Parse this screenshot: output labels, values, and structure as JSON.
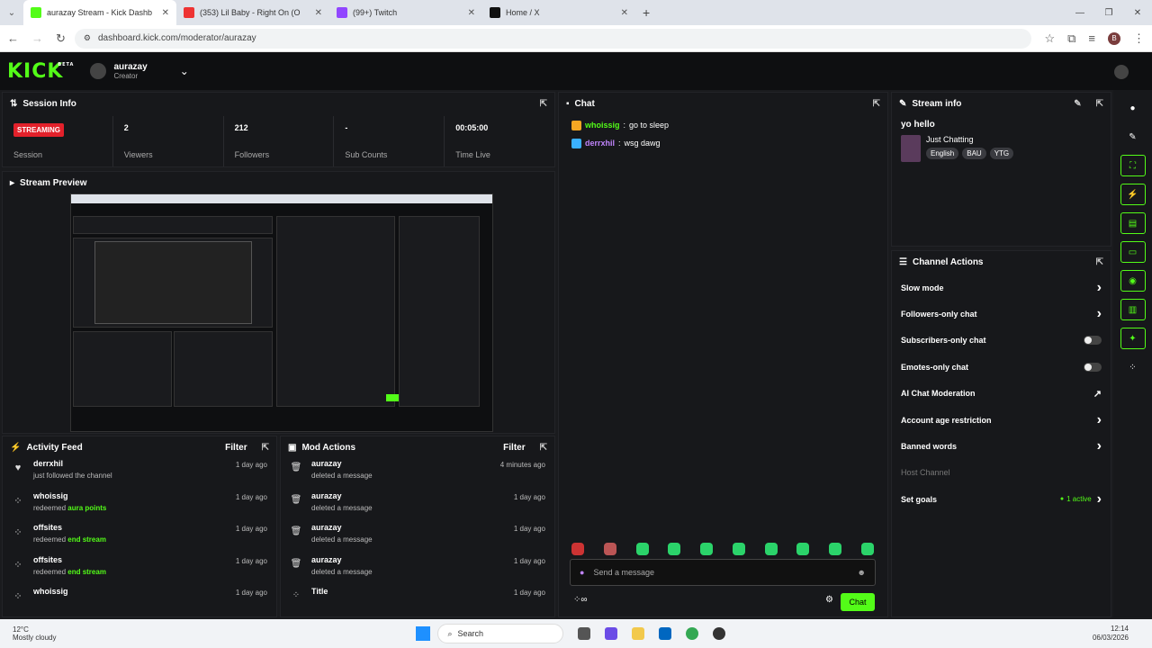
{
  "browser": {
    "tabs": [
      {
        "title": "aurazay Stream - Kick Dashb",
        "color": "#53fc18",
        "active": true
      },
      {
        "title": "(353) Lil Baby - Right On (O",
        "color": "#e33",
        "active": false
      },
      {
        "title": "(99+) Twitch",
        "color": "#9146ff",
        "active": false
      },
      {
        "title": "Home / X",
        "color": "#111",
        "active": false
      }
    ],
    "url": "dashboard.kick.com/moderator/aurazay",
    "profile_initial": "B"
  },
  "header": {
    "logo": "KICK",
    "beta": "BETA",
    "username": "aurazay",
    "role": "Creator"
  },
  "session": {
    "title": "Session Info",
    "badge": "STREAMING",
    "badge_sub": "Session",
    "stats": [
      {
        "value": "2",
        "label": "Viewers"
      },
      {
        "value": "212",
        "label": "Followers"
      },
      {
        "value": "-",
        "label": "Sub Counts"
      },
      {
        "value": "00:05:00",
        "label": "Time Live"
      }
    ]
  },
  "preview": {
    "title": "Stream Preview"
  },
  "activity": {
    "title": "Activity Feed",
    "filter": "Filter",
    "items": [
      {
        "icon": "♥",
        "name": "derrxhil",
        "sub": "just followed the channel",
        "hl": "",
        "time": "1 day ago"
      },
      {
        "icon": "⁘",
        "name": "whoissig",
        "sub": "redeemed ",
        "hl": "aura points",
        "time": "1 day ago"
      },
      {
        "icon": "⁘",
        "name": "offsites",
        "sub": "redeemed ",
        "hl": "end stream",
        "time": "1 day ago"
      },
      {
        "icon": "⁘",
        "name": "offsites",
        "sub": "redeemed ",
        "hl": "end stream",
        "time": "1 day ago"
      },
      {
        "icon": "⁘",
        "name": "whoissig",
        "sub": "",
        "hl": "",
        "time": "1 day ago"
      }
    ]
  },
  "mod": {
    "title": "Mod Actions",
    "filter": "Filter",
    "items": [
      {
        "name": "aurazay",
        "sub": "deleted a message",
        "time": "4 minutes ago"
      },
      {
        "name": "aurazay",
        "sub": "deleted a message",
        "time": "1 day ago"
      },
      {
        "name": "aurazay",
        "sub": "deleted a message",
        "time": "1 day ago"
      },
      {
        "name": "aurazay",
        "sub": "deleted a message",
        "time": "1 day ago"
      },
      {
        "name": "Title",
        "sub": "",
        "time": "1 day ago"
      }
    ]
  },
  "chat": {
    "title": "Chat",
    "messages": [
      {
        "user": "whoissig",
        "text": "go to sleep",
        "color": "#53fc18",
        "badge": "#f5a623"
      },
      {
        "user": "derrxhil",
        "text": "wsg dawg",
        "color": "#c084fc",
        "badge": "#3ab0ff"
      }
    ],
    "placeholder": "Send a message",
    "send": "Chat"
  },
  "stream_info": {
    "title": "Stream info",
    "stream_title": "yo hello",
    "category": "Just Chatting",
    "tags": [
      "English",
      "BAU",
      "YTG"
    ]
  },
  "actions": {
    "title": "Channel Actions",
    "items": [
      {
        "label": "Slow mode",
        "ctrl": "chevron"
      },
      {
        "label": "Followers-only chat",
        "ctrl": "chevron"
      },
      {
        "label": "Subscribers-only chat",
        "ctrl": "toggle"
      },
      {
        "label": "Emotes-only chat",
        "ctrl": "toggle"
      },
      {
        "label": "AI Chat Moderation",
        "ctrl": "external"
      },
      {
        "label": "Account age restriction",
        "ctrl": "chevron"
      },
      {
        "label": "Banned words",
        "ctrl": "chevron"
      },
      {
        "label": "Host Channel",
        "ctrl": "none"
      },
      {
        "label": "Set goals",
        "ctrl": "goals"
      }
    ],
    "goals_status": "1 active"
  },
  "taskbar": {
    "temp": "12°C",
    "weather": "Mostly cloudy",
    "search": "Search",
    "time": "12:14",
    "date": "06/03/2026"
  },
  "colors": {
    "accent": "#53fc18",
    "live": "#e3212b"
  }
}
